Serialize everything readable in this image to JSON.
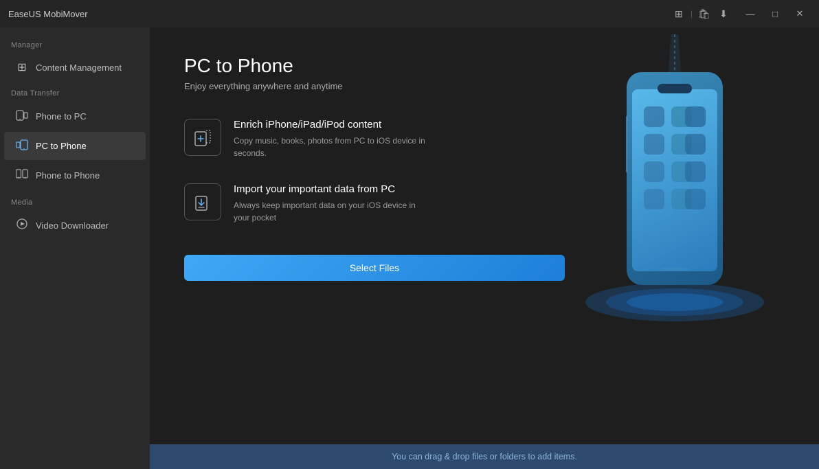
{
  "app": {
    "title": "EaseUS MobiMover"
  },
  "titlebar": {
    "icons": [
      "⊞",
      "🔗",
      "⬇"
    ],
    "minimize": "—",
    "maximize": "□",
    "close": "✕"
  },
  "sidebar": {
    "sections": [
      {
        "label": "Manager",
        "items": [
          {
            "id": "content-management",
            "label": "Content Management",
            "icon": "⊞",
            "active": false
          }
        ]
      },
      {
        "label": "Data Transfer",
        "items": [
          {
            "id": "phone-to-pc",
            "label": "Phone to PC",
            "icon": "📱",
            "active": false
          },
          {
            "id": "pc-to-phone",
            "label": "PC to Phone",
            "icon": "💻",
            "active": true
          },
          {
            "id": "phone-to-phone",
            "label": "Phone to Phone",
            "icon": "📲",
            "active": false
          }
        ]
      },
      {
        "label": "Media",
        "items": [
          {
            "id": "video-downloader",
            "label": "Video Downloader",
            "icon": "▶",
            "active": false
          }
        ]
      }
    ]
  },
  "content": {
    "title": "PC to Phone",
    "subtitle": "Enjoy everything anywhere and anytime",
    "features": [
      {
        "id": "enrich-content",
        "icon": "➕",
        "title": "Enrich iPhone/iPad/iPod content",
        "desc": "Copy music, books, photos from PC to iOS device in seconds."
      },
      {
        "id": "import-data",
        "icon": "⬆",
        "title": "Import your important data from PC",
        "desc": "Always keep important data on your iOS device in your pocket"
      }
    ],
    "select_files_label": "Select Files",
    "drag_drop_hint": "You can drag & drop files or folders to add items."
  }
}
